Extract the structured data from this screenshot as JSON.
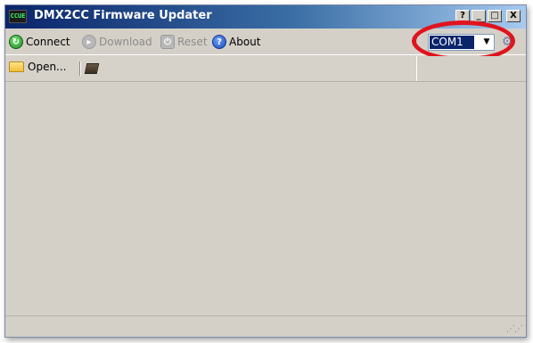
{
  "window": {
    "title": "DMX2CC Firmware Updater",
    "app_icon_text": "CCUE"
  },
  "title_buttons": {
    "help": "?",
    "minimize": "_",
    "maximize": "□",
    "close": "X"
  },
  "toolbar": {
    "connect_label": "Connect",
    "download_label": "Download",
    "reset_label": "Reset",
    "about_label": "About"
  },
  "port": {
    "selected": "COM1",
    "arrow": "▼"
  },
  "file_toolbar": {
    "open_label": "Open..."
  },
  "colors": {
    "accent": "#0a246a",
    "highlight": "#e0141e",
    "face": "#d4d0c8"
  }
}
